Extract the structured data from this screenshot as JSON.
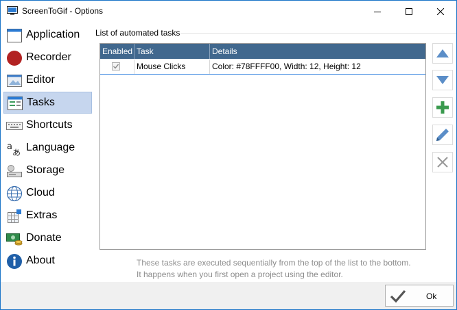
{
  "window": {
    "title": "ScreenToGif - Options",
    "controls": {
      "minimize": "minimize-icon",
      "maximize": "maximize-icon",
      "close": "close-icon"
    }
  },
  "sidebar": {
    "items": [
      {
        "label": "Application",
        "icon": "application-window-icon",
        "selected": false
      },
      {
        "label": "Recorder",
        "icon": "record-circle-icon",
        "selected": false
      },
      {
        "label": "Editor",
        "icon": "editor-image-icon",
        "selected": false
      },
      {
        "label": "Tasks",
        "icon": "tasks-list-icon",
        "selected": true
      },
      {
        "label": "Shortcuts",
        "icon": "keyboard-icon",
        "selected": false
      },
      {
        "label": "Language",
        "icon": "language-icon",
        "selected": false
      },
      {
        "label": "Storage",
        "icon": "storage-drive-icon",
        "selected": false
      },
      {
        "label": "Cloud",
        "icon": "globe-icon",
        "selected": false
      },
      {
        "label": "Extras",
        "icon": "extras-puzzle-icon",
        "selected": false
      },
      {
        "label": "Donate",
        "icon": "money-icon",
        "selected": false
      },
      {
        "label": "About",
        "icon": "info-icon",
        "selected": false
      }
    ]
  },
  "tasks": {
    "group_label": "List of automated tasks",
    "columns": [
      "Enabled",
      "Task",
      "Details"
    ],
    "rows": [
      {
        "enabled": true,
        "task": "Mouse Clicks",
        "details": "Color: #78FFFF00, Width: 12, Height: 12"
      }
    ],
    "actions": [
      "move-up-icon",
      "move-down-icon",
      "add-icon",
      "edit-pencil-icon",
      "remove-x-icon"
    ],
    "info_line1": "These tasks are executed sequentially from the top of the list to the bottom.",
    "info_line2": "It happens when you first open a project using the editor."
  },
  "footer": {
    "ok_label": "Ok"
  },
  "colors": {
    "accent": "#1a74c8",
    "grid_header": "#41688e",
    "selection": "#c6d6ee"
  }
}
